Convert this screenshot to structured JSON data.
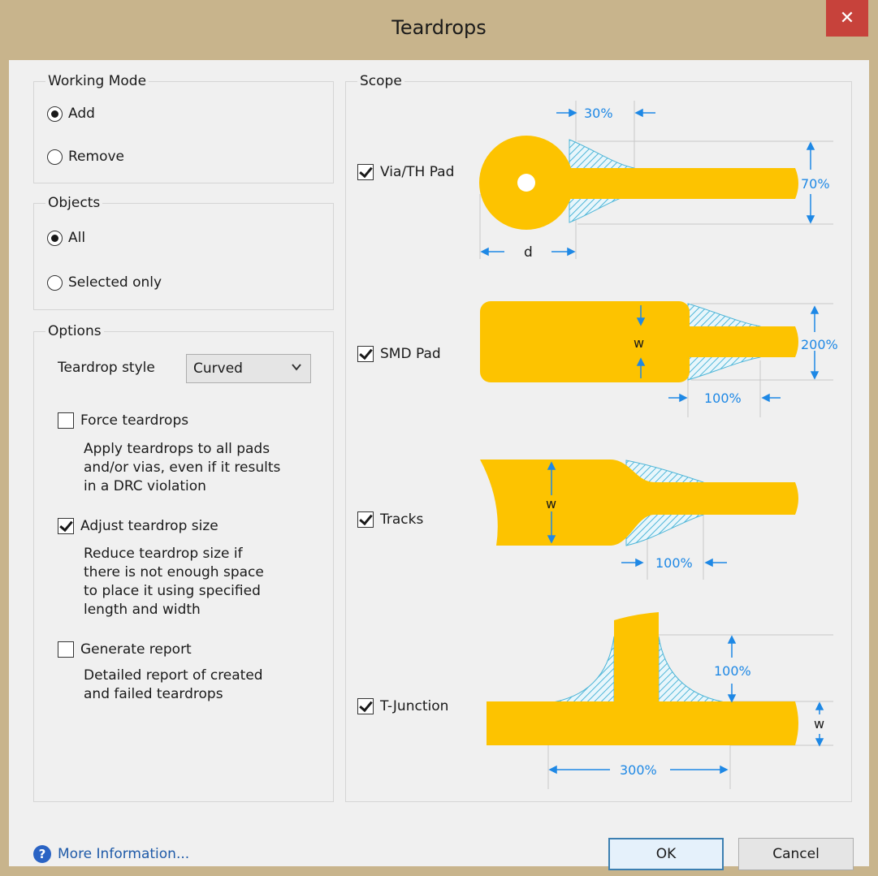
{
  "window": {
    "title": "Teardrops",
    "close_glyph": "✕"
  },
  "working_mode": {
    "label": "Working Mode",
    "options": [
      {
        "label": "Add",
        "selected": true
      },
      {
        "label": "Remove",
        "selected": false
      }
    ]
  },
  "objects": {
    "label": "Objects",
    "options": [
      {
        "label": "All",
        "selected": true
      },
      {
        "label": "Selected only",
        "selected": false
      }
    ]
  },
  "options": {
    "label": "Options",
    "teardrop_style_label": "Teardrop style",
    "teardrop_style_value": "Curved",
    "force": {
      "label": "Force teardrops",
      "checked": false,
      "description": "Apply teardrops to all pads\nand/or vias, even if it results\nin a DRC violation"
    },
    "adjust": {
      "label": "Adjust teardrop size",
      "checked": true,
      "description": "Reduce teardrop size if\nthere is not enough space\nto place it using specified\nlength and width"
    },
    "report": {
      "label": "Generate report",
      "checked": false,
      "description": "Detailed report of created\nand failed teardrops"
    }
  },
  "scope": {
    "label": "Scope",
    "items": [
      {
        "label": "Via/TH Pad",
        "checked": true
      },
      {
        "label": "SMD Pad",
        "checked": true
      },
      {
        "label": "Tracks",
        "checked": true
      },
      {
        "label": "T-Junction",
        "checked": true
      }
    ],
    "dims": {
      "via_length": "30%",
      "via_width": "70%",
      "via_d": "d",
      "smd_w": "w",
      "smd_width": "200%",
      "smd_length": "100%",
      "track_w": "w",
      "track_length": "100%",
      "tj_height": "100%",
      "tj_w": "w",
      "tj_length": "300%"
    }
  },
  "footer": {
    "help_icon": "?",
    "more_info": "More Information...",
    "ok": "OK",
    "cancel": "Cancel"
  },
  "colors": {
    "pad": "#fdc300",
    "dim": "#1e88e5",
    "hatch": "#4fb6d8",
    "title_bar": "#c8b48c",
    "close": "#c7423b"
  }
}
